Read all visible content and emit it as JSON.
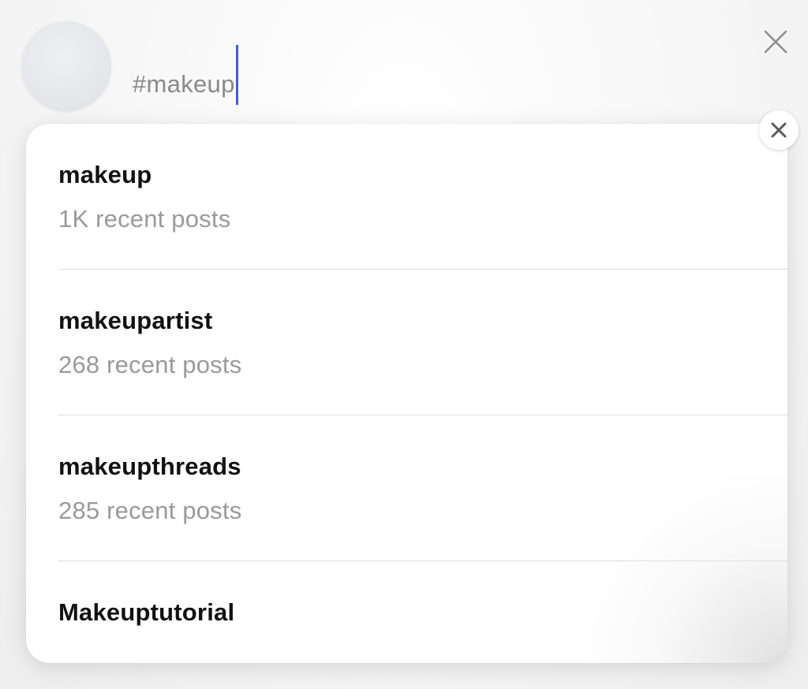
{
  "compose": {
    "input_value": "#makeup"
  },
  "icons": {
    "close_top": "close-icon",
    "close_dropdown": "close-circle-icon"
  },
  "colors": {
    "caret": "#3f5fd8",
    "primary_text": "#111111",
    "secondary_text": "#9a9a9a"
  },
  "suggestions": [
    {
      "name": "makeup",
      "count": "1K recent posts"
    },
    {
      "name": "makeupartist",
      "count": "268 recent posts"
    },
    {
      "name": "makeupthreads",
      "count": "285 recent posts"
    },
    {
      "name": "Makeuptutorial",
      "count": ""
    }
  ]
}
